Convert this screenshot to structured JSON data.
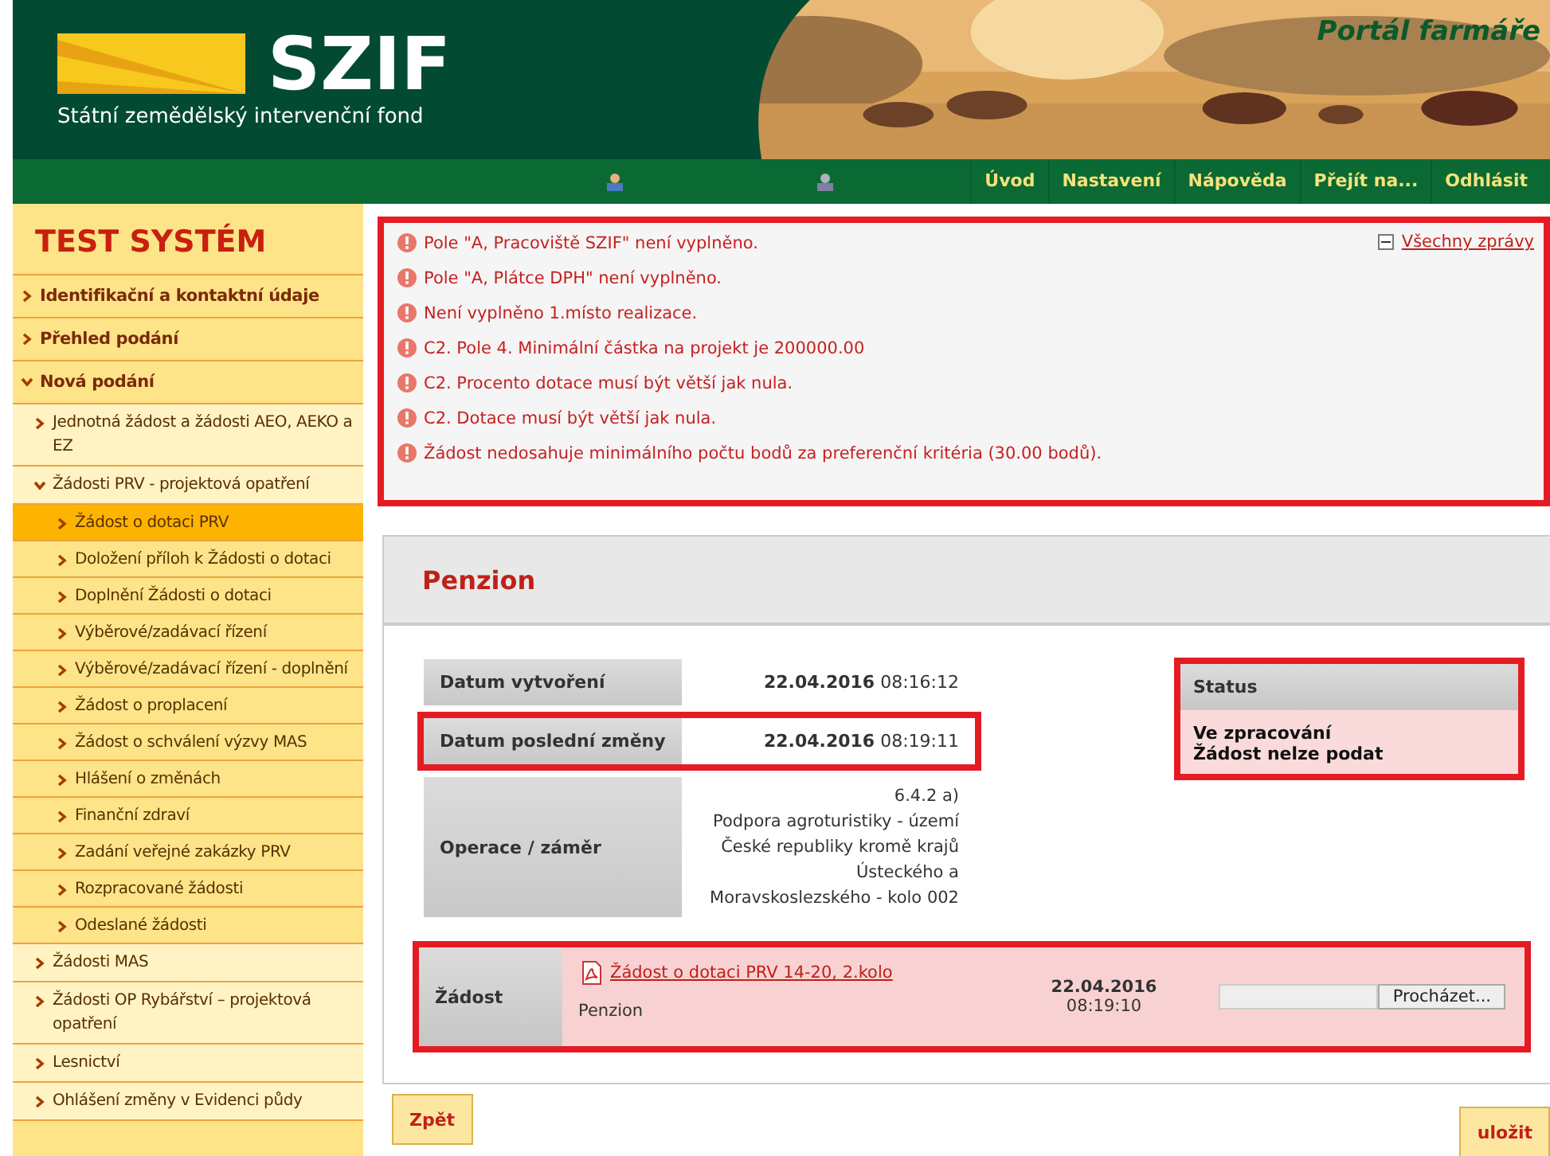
{
  "header": {
    "logo": "SZIF",
    "subtitle": "Státní zemědělský intervenční fond",
    "portal": "Portál farmáře"
  },
  "nav": {
    "links": [
      "Úvod",
      "Nastavení",
      "Nápověda",
      "Přejít na...",
      "Odhlásit"
    ]
  },
  "sidebar": {
    "title": "TEST SYSTÉM",
    "items": [
      {
        "label": "Identifikační a kontaktní údaje",
        "expanded": false,
        "selected": false
      },
      {
        "label": "Přehled podání",
        "expanded": false,
        "selected": false
      },
      {
        "label": "Nová podání",
        "expanded": true,
        "selected": false,
        "children": [
          {
            "label": "Jednotná žádost a žádosti AEO, AEKO a EZ",
            "expanded": false,
            "selected": false
          },
          {
            "label": "Žádosti PRV - projektová opatření",
            "expanded": true,
            "selected": false,
            "children": [
              {
                "label": "Žádost o dotaci PRV",
                "selected": true
              },
              {
                "label": "Doložení příloh k Žádosti o dotaci",
                "selected": false
              },
              {
                "label": "Doplnění Žádosti o dotaci",
                "selected": false
              },
              {
                "label": "Výběrové/zadávací řízení",
                "selected": false
              },
              {
                "label": "Výběrové/zadávací řízení - doplnění",
                "selected": false
              },
              {
                "label": "Žádost o proplacení",
                "selected": false
              },
              {
                "label": "Žádost o schválení výzvy MAS",
                "selected": false
              },
              {
                "label": "Hlášení o změnách",
                "selected": false
              },
              {
                "label": "Finanční zdraví",
                "selected": false
              },
              {
                "label": "Zadání veřejné zakázky PRV",
                "selected": false
              },
              {
                "label": "Rozpracované žádosti",
                "selected": false
              },
              {
                "label": "Odeslané žádosti",
                "selected": false
              }
            ]
          },
          {
            "label": "Žádosti MAS",
            "expanded": false,
            "selected": false
          },
          {
            "label": "Žádosti OP Rybářství – projektová opatření",
            "expanded": false,
            "selected": false
          },
          {
            "label": "Lesnictví",
            "expanded": false,
            "selected": false
          },
          {
            "label": "Ohlášení změny v Evidenci půdy",
            "expanded": false,
            "selected": false
          }
        ]
      }
    ]
  },
  "messages": {
    "highlighted": true,
    "toggle": "Všechny zprávy",
    "items": [
      "Pole \"A, Pracoviště SZIF\" není vyplněno.",
      "Pole \"A, Plátce DPH\" není vyplněno.",
      "Není vyplněno 1.místo realizace.",
      "C2. Pole 4. Minimální částka na projekt je 200000.00",
      "C2. Procento dotace musí být větší jak nula.",
      "C2. Dotace musí být větší jak nula.",
      "Žádost nedosahuje minimálního počtu bodů za preferenční kritéria (30.00 bodů)."
    ]
  },
  "panel": {
    "title": "Penzion",
    "info": [
      {
        "label": "Datum vytvoření",
        "date": "22.04.2016",
        "time": "08:16:12",
        "highlighted": false
      },
      {
        "label": "Datum poslední změny",
        "date": "22.04.2016",
        "time": "08:19:11",
        "highlighted": true
      }
    ],
    "operation": {
      "label": "Operace / záměr",
      "lines": [
        "6.4.2 a)",
        "Podpora agroturistiky - území",
        "České republiky kromě krajů",
        "Ústeckého a",
        "Moravskoslezského - kolo 002"
      ]
    },
    "status": {
      "label": "Status",
      "highlighted": true,
      "lines": [
        "Ve zpracování",
        "Žádost nelze podat"
      ]
    },
    "document": {
      "label": "Žádost",
      "highlighted": true,
      "link": "Žádost o dotaci PRV 14-20, 2.kolo",
      "description": "Penzion",
      "date": "22.04.2016",
      "time": "08:19:10",
      "browse": "Procházet..."
    }
  },
  "buttons": {
    "back": "Zpět",
    "save": "uložit"
  }
}
